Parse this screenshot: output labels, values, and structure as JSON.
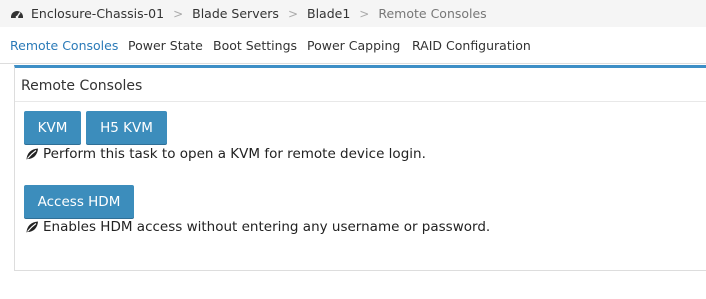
{
  "breadcrumb": {
    "icon": "dashboard-icon",
    "items": [
      "Enclosure-Chassis-01",
      "Blade Servers",
      "Blade1",
      "Remote Consoles"
    ],
    "separator": ">"
  },
  "tabs": [
    {
      "label": "Remote Consoles",
      "active": true
    },
    {
      "label": "Power State",
      "active": false
    },
    {
      "label": "Boot Settings",
      "active": false
    },
    {
      "label": "Power Capping",
      "active": false
    },
    {
      "label": "RAID Configuration",
      "active": false
    }
  ],
  "panel": {
    "title": "Remote Consoles",
    "kvm_label": "KVM",
    "h5kvm_label": "H5 KVM",
    "kvm_description": "Perform this task to open a KVM for remote device login.",
    "hdm_label": "Access HDM",
    "hdm_description": "Enables HDM access without entering any username or password.",
    "description_icon": "leaf-icon"
  },
  "colors": {
    "accent": "#3c8dbc",
    "active_tab": "#2a7ab8",
    "breadcrumb_bg": "#f5f5f5"
  }
}
